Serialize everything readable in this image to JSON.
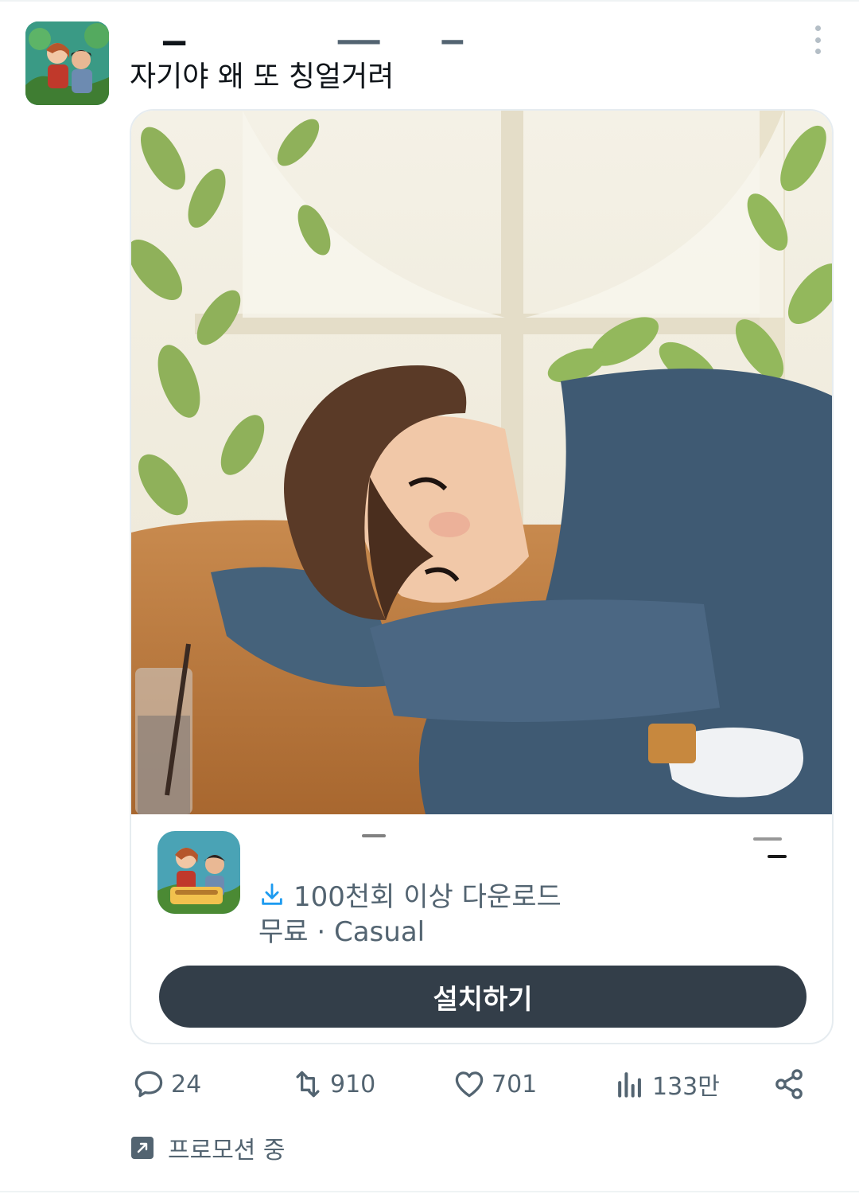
{
  "tweet": {
    "text": "자기야 왜 또 칭얼거려"
  },
  "card": {
    "downloads_text": "100천회 이상 다운로드",
    "meta_text": "무료 · Casual",
    "install_label": "설치하기"
  },
  "actions": {
    "reply_count": "24",
    "retweet_count": "910",
    "like_count": "701",
    "views_count": "133만"
  },
  "promo": {
    "label": "프로모션 중"
  },
  "icons": {
    "more": "more-vertical-icon",
    "download": "download-icon",
    "reply": "reply-icon",
    "retweet": "retweet-icon",
    "like": "heart-icon",
    "views": "views-bar-chart-icon",
    "share": "share-icon",
    "promo": "promoted-arrow-icon"
  },
  "colors": {
    "install_button": "#333e49",
    "secondary_text": "#536471",
    "download_icon": "#1d9bf0"
  }
}
